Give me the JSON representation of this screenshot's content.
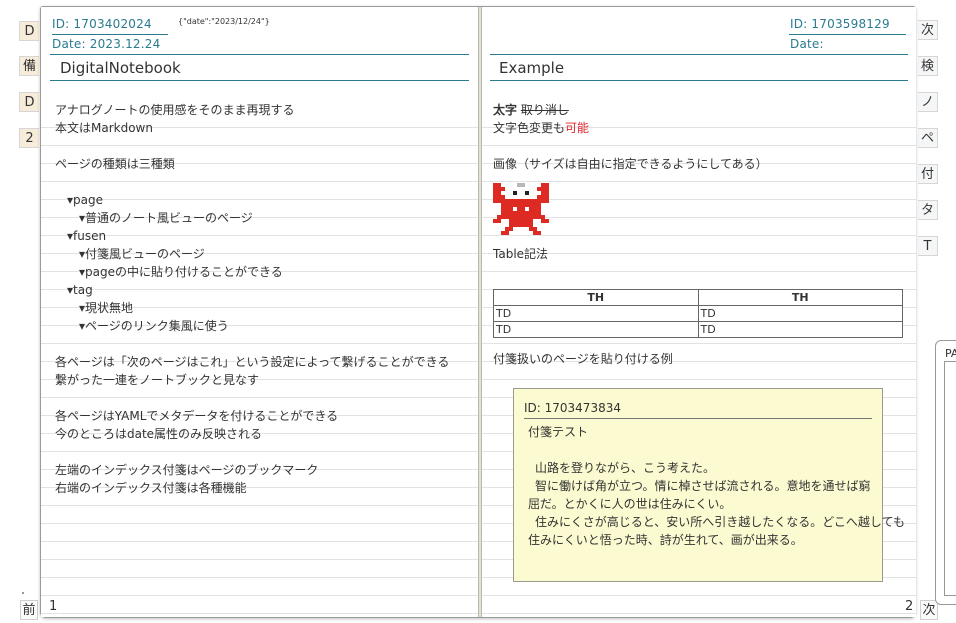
{
  "left_tabs": [
    "D",
    "備",
    "D",
    "2"
  ],
  "right_tabs": [
    "次",
    "検",
    "ノ",
    "ペ",
    "付",
    "タ",
    "T"
  ],
  "nav": {
    "prev_label": "前",
    "next_label": "次"
  },
  "left_page": {
    "id": "ID: 1703402024",
    "yaml": "{\"date\":\"2023/12/24\"}",
    "date": "Date: 2023.12.24",
    "title": "DigitalNotebook",
    "page_number": "1",
    "lines": [
      "アナログノートの使用感をそのまま再現する",
      "本文はMarkdown",
      "",
      "ページの種類は三種類",
      "",
      "▾page",
      "▾普通のノート風ビューのページ",
      "▾fusen",
      "▾付箋風ビューのページ",
      "▾pageの中に貼り付けることができる",
      "▾tag",
      "▾現状無地",
      "▾ページのリンク集風に使う",
      "",
      "各ページは「次のページはこれ」という設定によって繋げることができる",
      "繋がった一連をノートブックと見なす",
      "",
      "各ページはYAMLでメタデータを付けることができる",
      "今のところはdate属性のみ反映される",
      "",
      "左端のインデックス付箋はページのブックマーク",
      "右端のインデックス付箋は各種機能"
    ]
  },
  "right_page": {
    "id": "ID: 1703598129",
    "date": "Date:",
    "title": "Example",
    "page_number": "2",
    "bold": "太字",
    "strike": "取り消し",
    "color_prefix": "文字色変更も",
    "color_word": "可能",
    "image_caption": "画像（サイズは自由に指定できるようにしてある）",
    "table_caption": "Table記法",
    "table": {
      "headers": [
        "TH",
        "TH"
      ],
      "rows": [
        [
          "TD",
          "TD"
        ],
        [
          "TD",
          "TD"
        ]
      ]
    },
    "fusen_caption": "付箋扱いのページを貼り付ける例"
  },
  "fusen": {
    "id": "ID: 1703473834",
    "title": "付箋テスト",
    "lines": [
      "山路を登りながら、こう考えた。",
      "智に働けば角が立つ。情に棹させば流される。意地を通せば窮",
      "屈だ。とかくに人の世は住みにくい。",
      "住みにくさが高じると、安い所へ引き越したくなる。どこへ越しても",
      "住みにくいと悟った時、詩が生れて、画が出来る。"
    ]
  },
  "side_panel": {
    "label": "PA"
  },
  "colors": {
    "accent": "#2a7b8f",
    "red": "#e0242a",
    "fusen_bg": "#fbfad0",
    "left_tab_bg": "#f7ecd9"
  }
}
